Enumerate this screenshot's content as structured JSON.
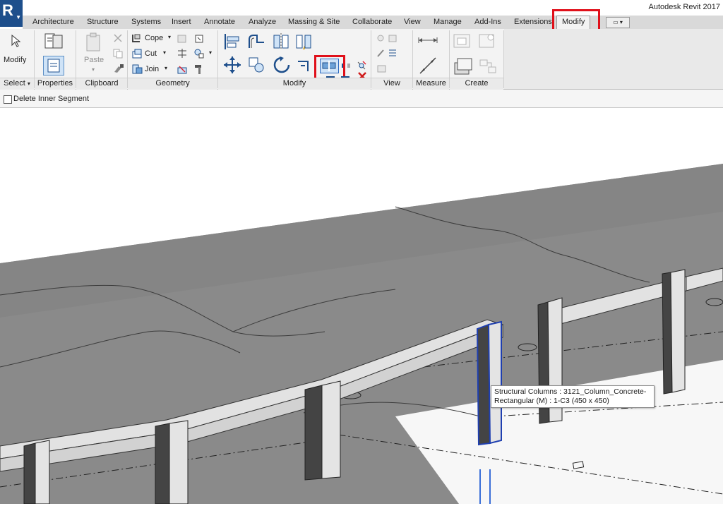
{
  "app": {
    "title": "Autodesk Revit 2017",
    "logo_letter": "R"
  },
  "tabs": [
    {
      "label": "Architecture"
    },
    {
      "label": "Structure"
    },
    {
      "label": "Systems"
    },
    {
      "label": "Insert"
    },
    {
      "label": "Annotate"
    },
    {
      "label": "Analyze"
    },
    {
      "label": "Massing & Site"
    },
    {
      "label": "Collaborate"
    },
    {
      "label": "View"
    },
    {
      "label": "Manage"
    },
    {
      "label": "Add-Ins"
    },
    {
      "label": "Extensions"
    },
    {
      "label": "Modify",
      "active": true
    }
  ],
  "ribbon": {
    "modify_label": "Modify",
    "paste_label": "Paste",
    "cope_label": "Cope",
    "cut_label": "Cut",
    "join_label": "Join",
    "panels": {
      "select": "Select",
      "properties": "Properties",
      "clipboard": "Clipboard",
      "geometry": "Geometry",
      "modify": "Modify",
      "view": "View",
      "measure": "Measure",
      "create": "Create"
    }
  },
  "options_bar": {
    "delete_inner_segment": "Delete Inner Segment",
    "checked": false
  },
  "tooltip": {
    "line1": "Structural Columns : 3121_Column_Concrete-",
    "line2": "Rectangular (M) : 1-C3 (450 x 450)"
  },
  "colors": {
    "highlight": "#e0101a",
    "selection": "#1f3fb0",
    "accent": "#1e4f8c"
  },
  "icons": [
    "modify-cursor-icon",
    "properties-icon",
    "type-properties-icon",
    "paste-icon",
    "cope-icon",
    "cut-icon",
    "join-icon",
    "align-icon",
    "offset-icon",
    "mirror-axis-icon",
    "mirror-draw-icon",
    "split-element-icon",
    "split-with-gap-icon",
    "move-icon",
    "copy-icon",
    "rotate-icon",
    "trim-extend-icon",
    "delete-icon",
    "measure-icon",
    "create-part-icon"
  ]
}
